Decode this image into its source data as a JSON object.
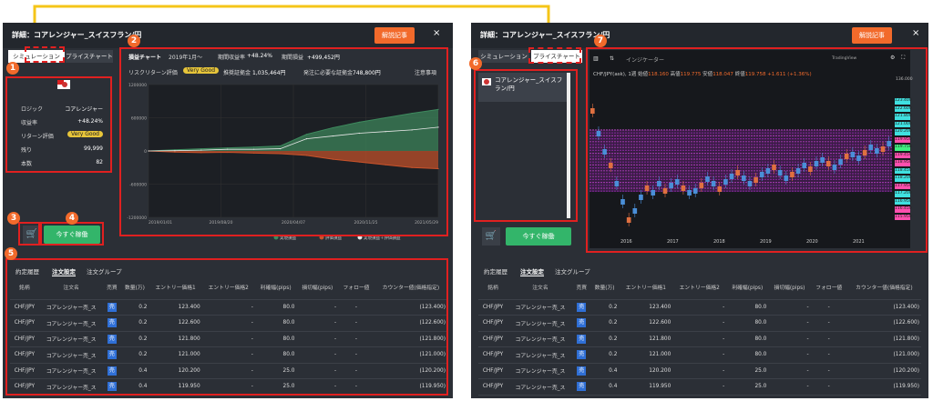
{
  "arrow_color": "#f5c518",
  "left": {
    "title": "詳細：コアレンジャー_スイスフラン/円",
    "explain_btn": "解説記事",
    "close": "×",
    "tabs": [
      "シミュレーション",
      "プライスチャート"
    ],
    "badges": [
      "1",
      "2",
      "3",
      "4",
      "5"
    ],
    "info": {
      "logic_label": "ロジック",
      "logic_value": "コアレンジャー",
      "return_label": "収益率",
      "return_value": "+48.24%",
      "eval_label": "リターン評価",
      "eval_value": "Very Good",
      "remain_label": "残り",
      "remain_value": "99,999",
      "count_label": "本数",
      "count_value": "82"
    },
    "buy_btn": "今すぐ稼働",
    "chart_header": {
      "label": "損益チャート",
      "period": "2019年1月～",
      "ret_label": "期間収益率",
      "ret_value": "+48.24%",
      "pl_label": "期間損益",
      "pl_value": "+499,452円",
      "risk_label": "リスクリターン評価",
      "risk_value": "Very Good",
      "margin_label": "推奨証拠金",
      "margin_value": "1,035,464円",
      "need_label": "発注に必要な証拠金",
      "need_value": "748,800円",
      "notes": "注意事項"
    },
    "legend": [
      "実現損益",
      "評価損益",
      "実現損益＋評価損益"
    ]
  },
  "right": {
    "title": "詳細：コアレンジャー_スイスフラン/円",
    "explain_btn": "解説記事",
    "close": "×",
    "tabs": [
      "シミュレーション",
      "プライスチャート"
    ],
    "badges": [
      "6",
      "7"
    ],
    "strategy_label": "コアレンジャー_スイスフラン/円",
    "buy_btn": "今すぐ稼働",
    "toolbar_indicator": "インジケーター",
    "tradingview": "TradingView",
    "ohlc": {
      "symbol": "CHF/JPY(ask), 1週",
      "open_label": "始値",
      "open": "118.160",
      "high_label": "高値",
      "high": "119.775",
      "low_label": "安値",
      "low": "118.047",
      "close_label": "終値",
      "close": "119.758",
      "change": "+1.611 (+1.36%)"
    },
    "y_top": "136.000",
    "price_labels": [
      "123.400",
      "122.600",
      "121.800",
      "121.000",
      "120.200",
      "119.950",
      "119.758",
      "119.450",
      "118.950",
      "118.450",
      "118.200",
      "117.950",
      "117.200",
      "116.950",
      "116.450",
      "115.950"
    ],
    "x_labels": [
      "2016",
      "2017",
      "2018",
      "2019",
      "2020",
      "2021"
    ]
  },
  "chart_data": {
    "type": "area",
    "x_ticks": [
      "2019/01/01",
      "2019/08/20",
      "2020/04/07",
      "2020/11/25",
      "2021/05/29"
    ],
    "y_ticks": [
      "1200000",
      "600000",
      "0",
      "-600000",
      "-1200000"
    ],
    "ylim": [
      -1200000,
      1200000
    ],
    "series": [
      {
        "name": "実現損益",
        "values": [
          0,
          20000,
          40000,
          55000,
          70000,
          90000,
          300000,
          420000,
          520000,
          600000,
          680000,
          750000
        ]
      },
      {
        "name": "評価損益",
        "values": [
          0,
          -20000,
          -30000,
          -25000,
          -40000,
          -50000,
          -80000,
          -150000,
          -200000,
          -250000,
          -300000,
          -320000
        ]
      },
      {
        "name": "実現損益＋評価損益",
        "values": [
          0,
          5000,
          15000,
          30000,
          30000,
          40000,
          220000,
          270000,
          320000,
          350000,
          380000,
          430000
        ]
      }
    ]
  },
  "table": {
    "sub_tabs": [
      "約定履歴",
      "注文設定",
      "注文グループ"
    ],
    "headers": [
      "銘柄",
      "注文名",
      "売買",
      "数量(万)",
      "エントリー価格1",
      "エントリー価格2",
      "利確幅(pips)",
      "損切幅(pips)",
      "フォロー値",
      "カウンター値(価格指定)"
    ],
    "rows": [
      [
        "CHF/JPY",
        "コアレンジャー売_ス",
        "売",
        "0.2",
        "123.400",
        "-",
        "80.0",
        "-",
        "-",
        "(123.400)"
      ],
      [
        "CHF/JPY",
        "コアレンジャー売_ス",
        "売",
        "0.2",
        "122.600",
        "-",
        "80.0",
        "-",
        "-",
        "(122.600)"
      ],
      [
        "CHF/JPY",
        "コアレンジャー売_ス",
        "売",
        "0.2",
        "121.800",
        "-",
        "80.0",
        "-",
        "-",
        "(121.800)"
      ],
      [
        "CHF/JPY",
        "コアレンジャー売_ス",
        "売",
        "0.2",
        "121.000",
        "-",
        "80.0",
        "-",
        "-",
        "(121.000)"
      ],
      [
        "CHF/JPY",
        "コアレンジャー売_ス",
        "売",
        "0.4",
        "120.200",
        "-",
        "25.0",
        "-",
        "-",
        "(120.200)"
      ],
      [
        "CHF/JPY",
        "コアレンジャー売_ス",
        "売",
        "0.4",
        "119.950",
        "-",
        "25.0",
        "-",
        "-",
        "(119.950)"
      ]
    ]
  }
}
